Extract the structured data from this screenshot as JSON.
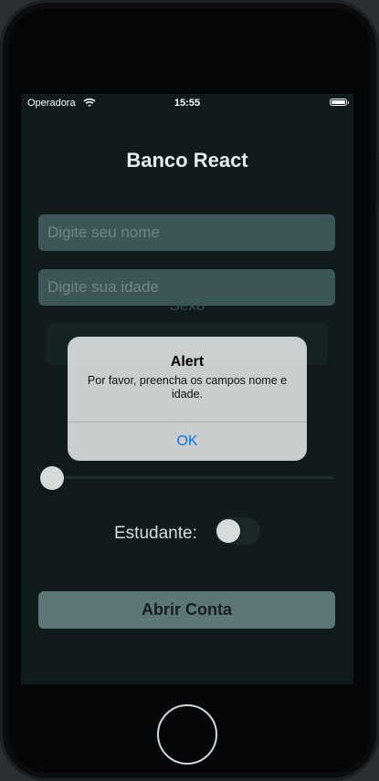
{
  "status_bar": {
    "carrier": "Operadora",
    "time": "15:55"
  },
  "app": {
    "title": "Banco React"
  },
  "form": {
    "name_placeholder": "Digite seu nome",
    "age_placeholder": "Digite sua idade",
    "sexo_label": "Sexo",
    "slider_value": 0,
    "student_label": "Estudante:",
    "student_enabled": false,
    "submit_label": "Abrir Conta"
  },
  "alert": {
    "title": "Alert",
    "message": "Por favor, preencha os campos nome e idade.",
    "ok_label": "OK"
  },
  "colors": {
    "screen_bg": "#111b1c",
    "input_bg": "#3d5658",
    "button_bg": "#5d7677",
    "alert_ok": "#0a78f0"
  }
}
